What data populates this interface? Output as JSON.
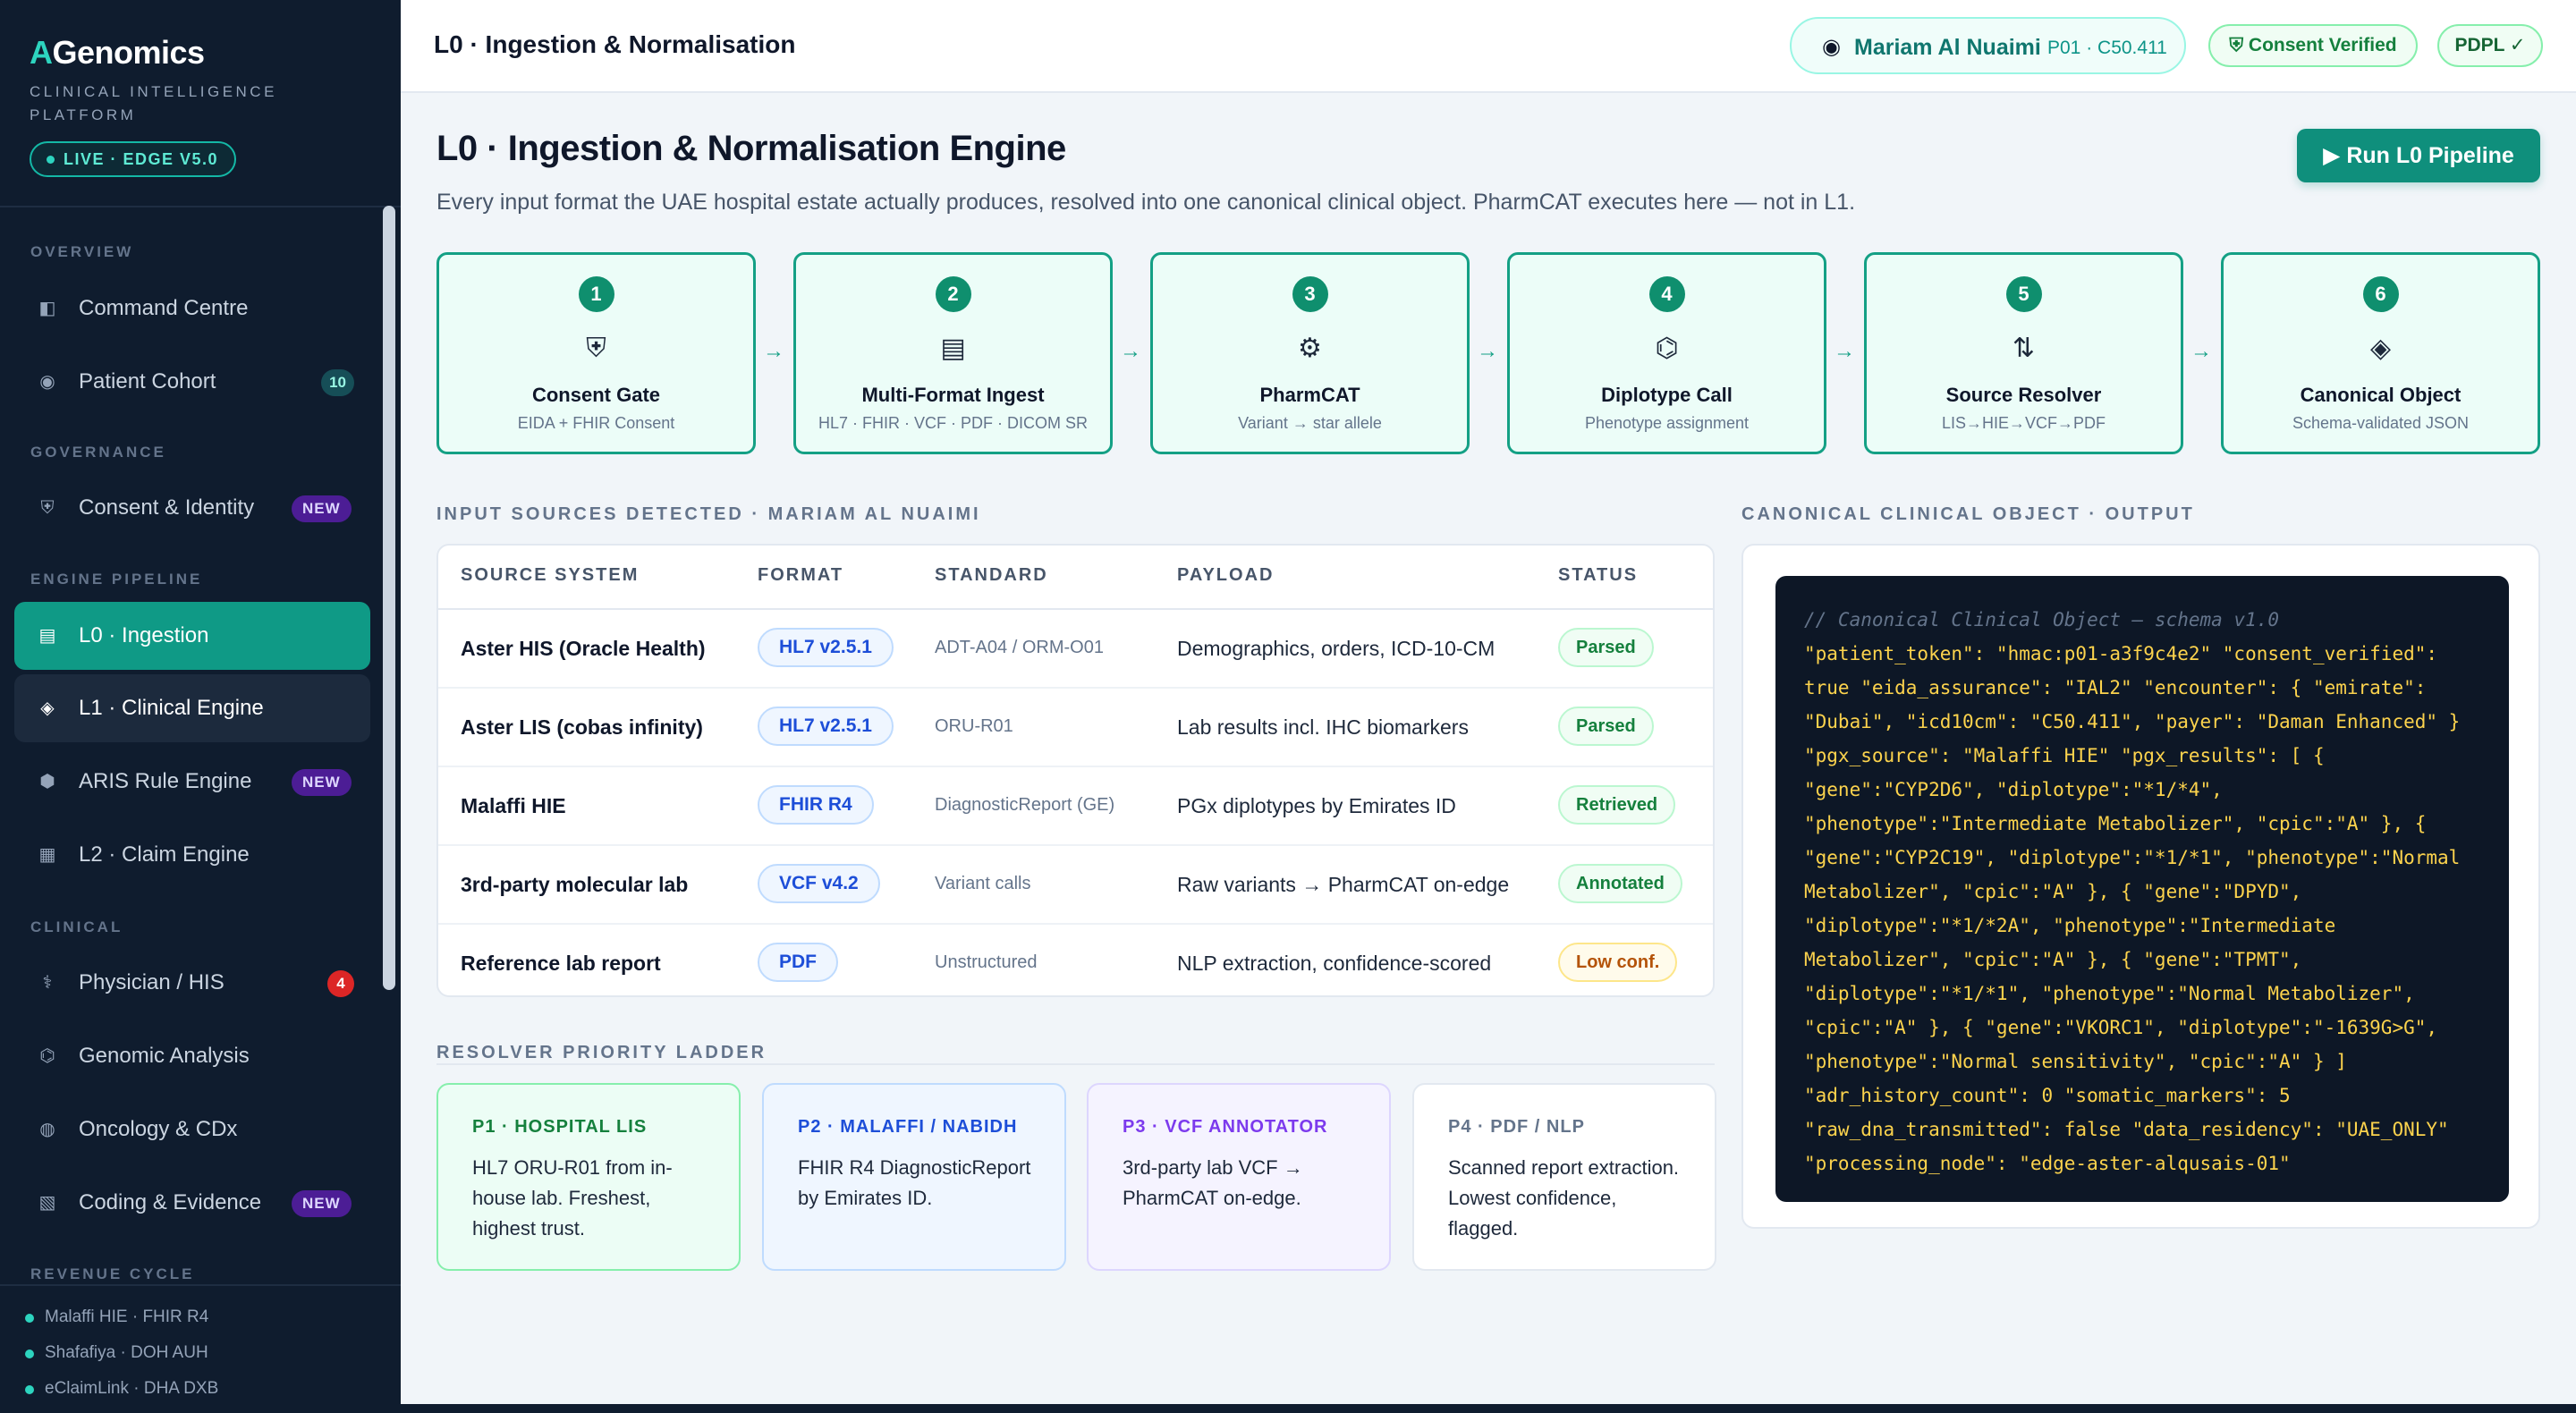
{
  "sidebar": {
    "brand_a": "A",
    "brand_rest": "Genomics",
    "subtitle": "CLINICAL INTELLIGENCE PLATFORM",
    "live_badge": "LIVE · EDGE V5.0",
    "sections": [
      "OVERVIEW",
      "GOVERNANCE",
      "ENGINE PIPELINE",
      "CLINICAL",
      "REVENUE CYCLE"
    ],
    "items": [
      {
        "label": "Command Centre",
        "icon": "◧"
      },
      {
        "label": "Patient Cohort",
        "icon": "◉",
        "count": "10"
      },
      {
        "label": "Consent & Identity",
        "icon": "⛨",
        "badge": "NEW"
      },
      {
        "label": "L0 · Ingestion",
        "icon": "▤"
      },
      {
        "label": "L1 · Clinical Engine",
        "icon": "◈"
      },
      {
        "label": "ARIS Rule Engine",
        "icon": "⬢",
        "badge": "NEW"
      },
      {
        "label": "L2 · Claim Engine",
        "icon": "▦"
      },
      {
        "label": "Physician / HIS",
        "icon": "⚕",
        "count": "4"
      },
      {
        "label": "Genomic Analysis",
        "icon": "⌬"
      },
      {
        "label": "Oncology & CDx",
        "icon": "◍"
      },
      {
        "label": "Coding & Evidence",
        "icon": "▧",
        "badge": "NEW"
      }
    ],
    "integrations": [
      "Malaffi HIE · FHIR R4",
      "Shafafiya · DOH AUH",
      "eClaimLink · DHA DXB"
    ]
  },
  "topbar": {
    "title": "L0 · Ingestion & Normalisation",
    "patient_icon": "◉",
    "patient_name": "Mariam Al Nuaimi",
    "patient_id": "P01 · C50.411",
    "consent": "⛨ Consent Verified",
    "pdpl": "PDPL ✓"
  },
  "main": {
    "title": "L0 · Ingestion & Normalisation Engine",
    "subtitle": "Every input format the UAE hospital estate actually produces, resolved into one canonical clinical object. PharmCAT executes here — not in L1.",
    "run_button": "▶ Run L0 Pipeline",
    "steps": [
      {
        "num": "1",
        "icon": "⛨",
        "title": "Consent Gate",
        "sub": "EIDA + FHIR Consent"
      },
      {
        "num": "2",
        "icon": "▤",
        "title": "Multi-Format Ingest",
        "sub": "HL7 · FHIR · VCF · PDF · DICOM SR"
      },
      {
        "num": "3",
        "icon": "⚙",
        "title": "PharmCAT",
        "sub": "Variant → star allele"
      },
      {
        "num": "4",
        "icon": "⌬",
        "title": "Diplotype Call",
        "sub": "Phenotype assignment"
      },
      {
        "num": "5",
        "icon": "⇅",
        "title": "Source Resolver",
        "sub": "LIS→HIE→VCF→PDF"
      },
      {
        "num": "6",
        "icon": "◈",
        "title": "Canonical Object",
        "sub": "Schema-validated JSON"
      }
    ],
    "step_arrow": "→",
    "sources_label": "INPUT SOURCES DETECTED ·  MARIAM AL NUAIMI",
    "output_label": "CANONICAL CLINICAL OBJECT · OUTPUT",
    "table": {
      "headers": [
        "SOURCE SYSTEM",
        "FORMAT",
        "STANDARD",
        "PAYLOAD",
        "STATUS"
      ],
      "rows": [
        {
          "source": "Aster HIS (Oracle Health)",
          "format": "HL7 v2.5.1",
          "standard": "ADT-A04 / ORM-O01",
          "payload": "Demographics, orders, ICD-10-CM",
          "status": "Parsed"
        },
        {
          "source": "Aster LIS (cobas infinity)",
          "format": "HL7 v2.5.1",
          "standard": "ORU-R01",
          "payload": "Lab results incl. IHC biomarkers",
          "status": "Parsed"
        },
        {
          "source": "Malaffi HIE",
          "format": "FHIR R4",
          "standard": "DiagnosticReport (GE)",
          "payload": "PGx diplotypes by Emirates ID",
          "status": "Retrieved"
        },
        {
          "source": "3rd-party molecular lab",
          "format": "VCF v4.2",
          "standard": "Variant calls",
          "payload": "Raw variants → PharmCAT on-edge",
          "status": "Annotated"
        },
        {
          "source": "Reference lab report",
          "format": "PDF",
          "standard": "Unstructured",
          "payload": "NLP extraction, confidence-scored",
          "status": "Low conf."
        }
      ]
    },
    "ladder_label": "RESOLVER PRIORITY LADDER",
    "priorities": [
      {
        "head": "P1 · HOSPITAL LIS",
        "body": "HL7 ORU-R01 from in-house lab. Freshest, highest trust."
      },
      {
        "head": "P2 · MALAFFI / NABIDH",
        "body": "FHIR R4 DiagnosticReport by Emirates ID."
      },
      {
        "head": "P3 · VCF ANNOTATOR",
        "body": "3rd-party lab VCF → PharmCAT on-edge."
      },
      {
        "head": "P4 · PDF / NLP",
        "body": "Scanned report extraction. Lowest confidence, flagged."
      }
    ],
    "code_comment": "// Canonical Clinical Object — schema v1.0",
    "code_body": "\"patient_token\": \"hmac:p01-a3f9c4e2\" \"consent_verified\": true \"eida_assurance\": \"IAL2\" \"encounter\": { \"emirate\": \"Dubai\", \"icd10cm\": \"C50.411\", \"payer\": \"Daman Enhanced\" } \"pgx_source\": \"Malaffi HIE\" \"pgx_results\": [ { \"gene\":\"CYP2D6\", \"diplotype\":\"*1/*4\", \"phenotype\":\"Intermediate Metabolizer\", \"cpic\":\"A\" }, { \"gene\":\"CYP2C19\", \"diplotype\":\"*1/*1\", \"phenotype\":\"Normal Metabolizer\", \"cpic\":\"A\" }, { \"gene\":\"DPYD\", \"diplotype\":\"*1/*2A\", \"phenotype\":\"Intermediate Metabolizer\", \"cpic\":\"A\" }, { \"gene\":\"TPMT\", \"diplotype\":\"*1/*1\", \"phenotype\":\"Normal Metabolizer\", \"cpic\":\"A\" }, { \"gene\":\"VKORC1\", \"diplotype\":\"-1639G>G\", \"phenotype\":\"Normal sensitivity\", \"cpic\":\"A\" } ] \"adr_history_count\": 0 \"somatic_markers\": 5 \"raw_dna_transmitted\": false \"data_residency\": \"UAE_ONLY\" \"processing_node\": \"edge-aster-alqusais-01\""
  },
  "colors": {
    "sidebar_bg": "#0f1c2e",
    "accent_teal": "#0f8f7c",
    "step_border": "#14a085",
    "code_bg": "#0d1726",
    "code_text": "#fcd34d"
  }
}
